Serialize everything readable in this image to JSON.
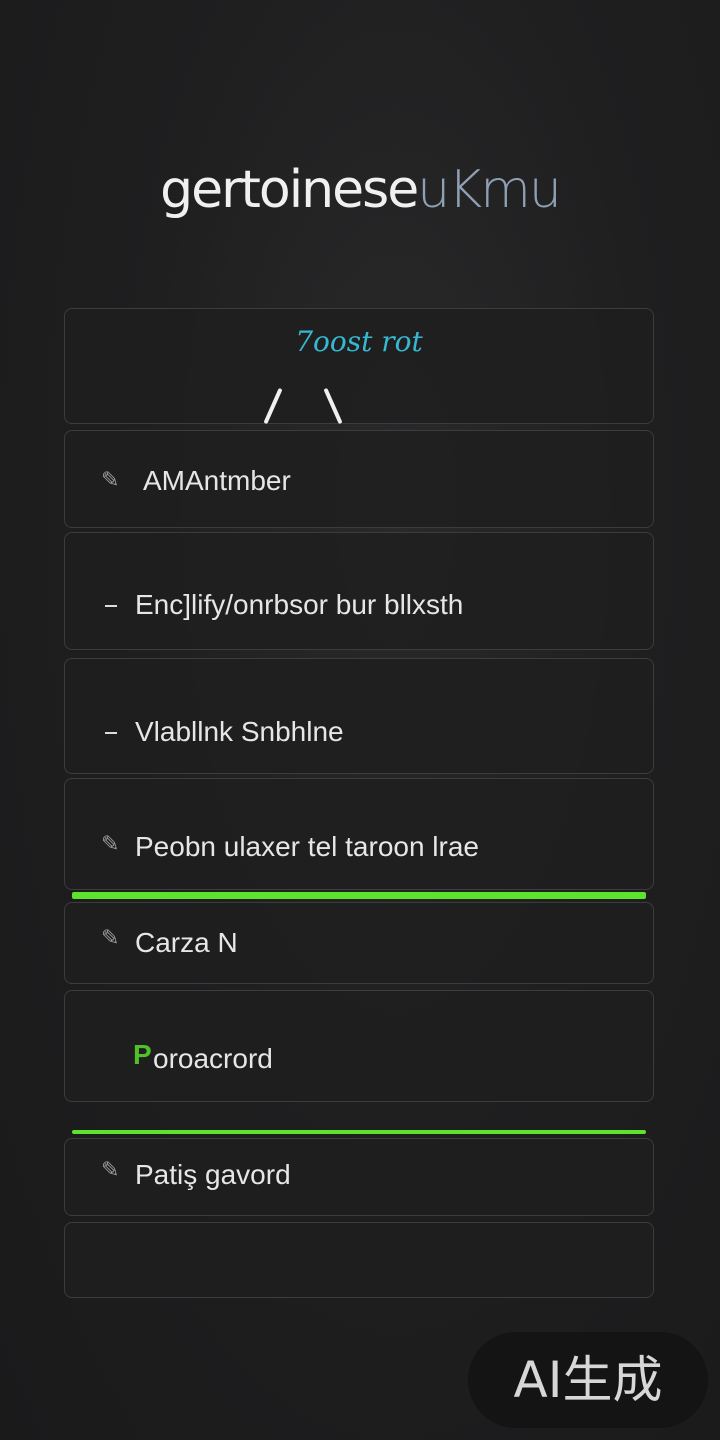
{
  "app": {
    "title": "gertoinese",
    "title_accent": "uKmu"
  },
  "header_card": {
    "heading": "7oost rot"
  },
  "rows": [
    {
      "label": "AMAntmber",
      "icon": "pen-icon"
    },
    {
      "label": "Enc]lify/onrbsor bur bllxsth",
      "icon": "dash-icon"
    },
    {
      "label": "Vlabllnk Snbhlne",
      "icon": "dash-icon"
    },
    {
      "label": "Peobn ulaxer tel taroon lrae",
      "icon": "pen-icon"
    },
    {
      "label": "Carza N",
      "icon": "pen-icon"
    },
    {
      "label": "oroacrord",
      "icon": "check-icon"
    },
    {
      "label": "Patiş gavord",
      "icon": "pen-icon"
    }
  ],
  "progress": {
    "bar_1": 1.0,
    "bar_2": 1.0
  },
  "colors": {
    "accent_green": "#5de22d",
    "heading_cyan": "#36b8d2",
    "background": "#1f1f20"
  },
  "watermark": {
    "text": "AI生成"
  }
}
